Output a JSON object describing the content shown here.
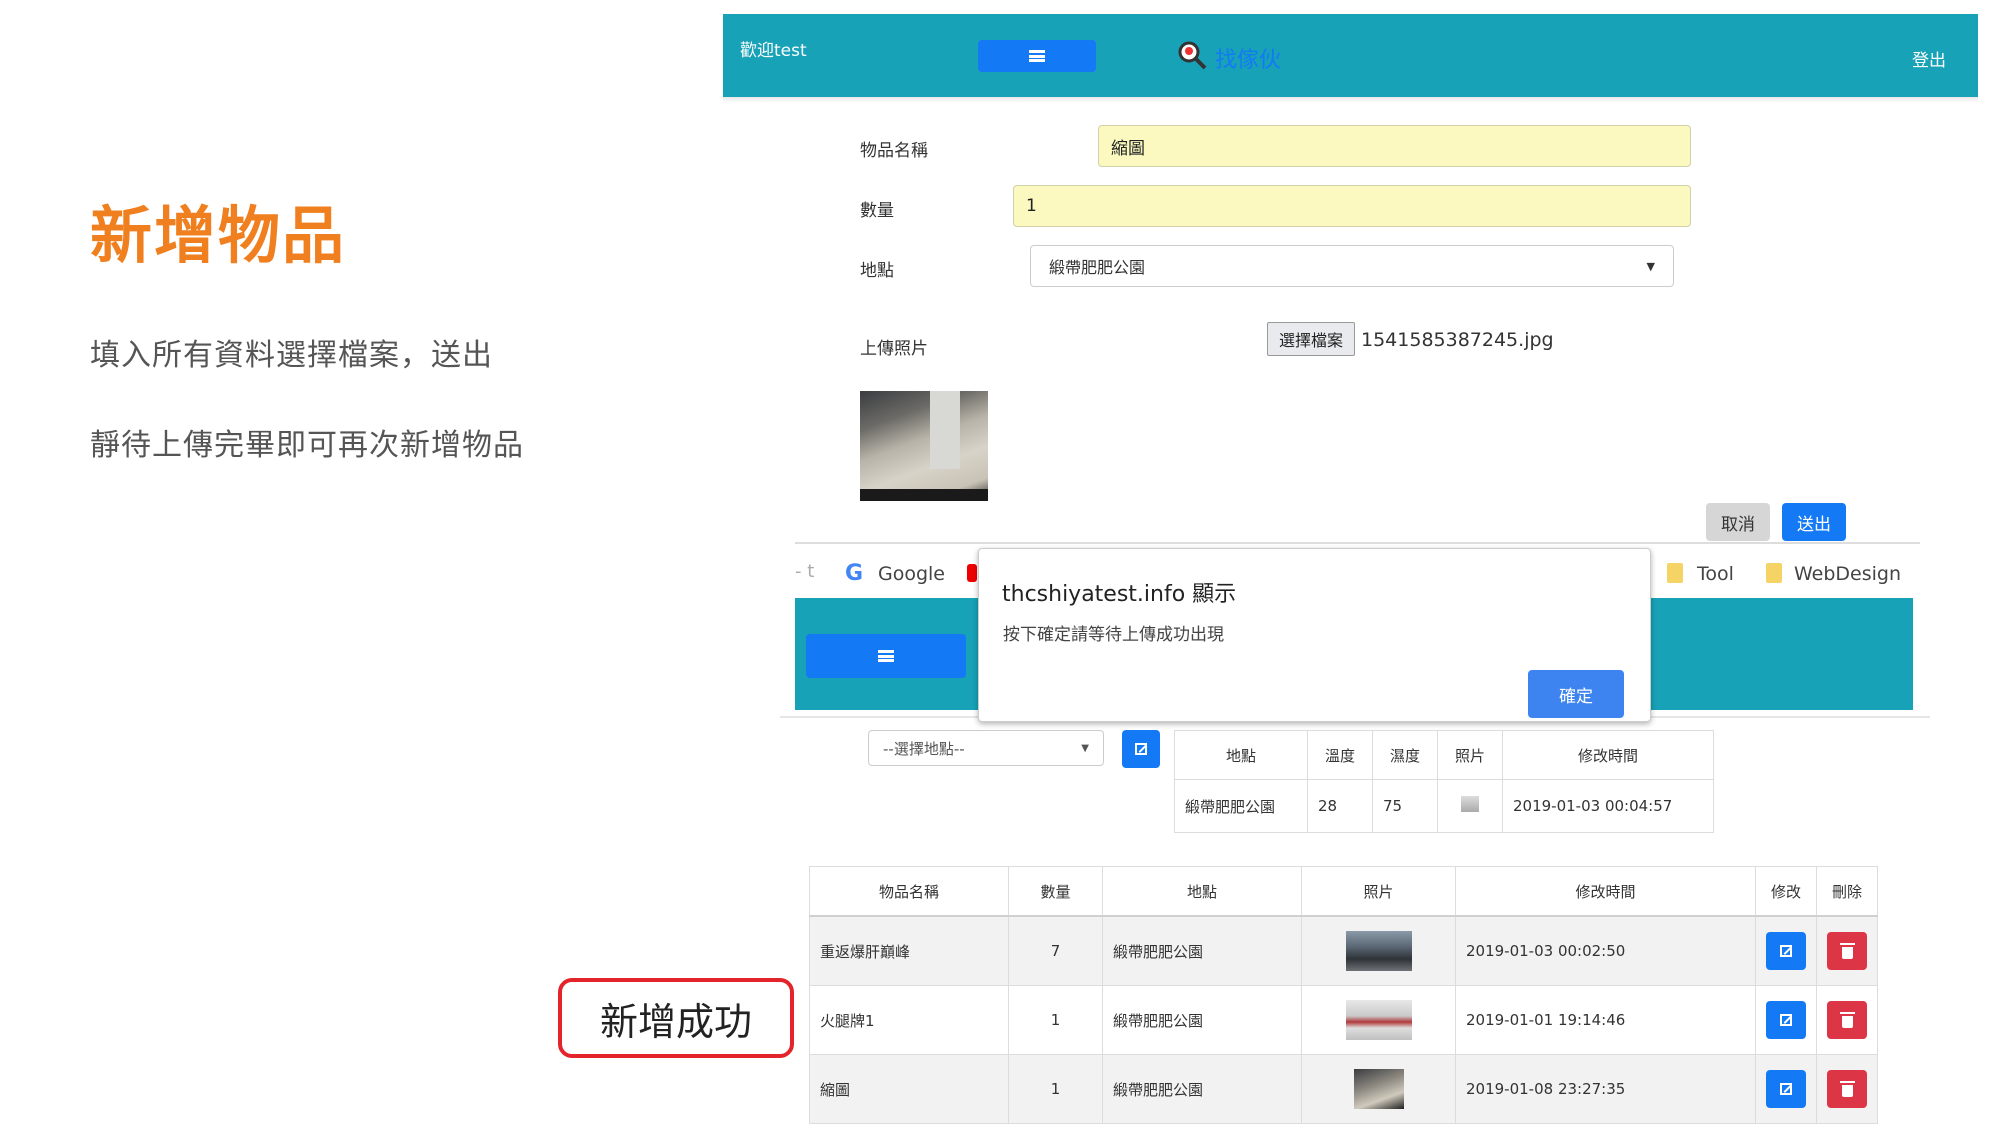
{
  "slide": {
    "title": "新增物品",
    "line1": "填入所有資料選擇檔案，送出",
    "line2": "靜待上傳完畢即可再次新增物品",
    "success_label": "新增成功"
  },
  "app": {
    "welcome": "歡迎test",
    "brand": "找傢伙",
    "logout": "登出",
    "accent_color": "#17a2b8",
    "primary_color": "#1479f5"
  },
  "form": {
    "name_label": "物品名稱",
    "name_value": "縮圖",
    "qty_label": "數量",
    "qty_value": "1",
    "place_label": "地點",
    "place_value": "緞帶肥肥公園",
    "upload_label": "上傳照片",
    "file_button": "選擇檔案",
    "file_name": "1541585387245.jpg",
    "cancel": "取消",
    "submit": "送出"
  },
  "browser": {
    "bookmark_google": "Google",
    "bookmark_tool": "Tool",
    "bookmark_webdesign": "WebDesign",
    "bookmark_dash": "- t"
  },
  "alert": {
    "title": "thcshiyatest.info 顯示",
    "message": "按下確定請等待上傳成功出現",
    "ok": "確定"
  },
  "filter": {
    "placeholder": "--選擇地點--"
  },
  "env_table": {
    "headers": [
      "地點",
      "溫度",
      "濕度",
      "照片",
      "修改時間"
    ],
    "row": {
      "place": "緞帶肥肥公園",
      "temp": "28",
      "humidity": "75",
      "time": "2019-01-03 00:04:57"
    }
  },
  "items_table": {
    "headers": [
      "物品名稱",
      "數量",
      "地點",
      "照片",
      "修改時間",
      "修改",
      "刪除"
    ],
    "rows": [
      {
        "name": "重返爆肝巔峰",
        "qty": "7",
        "place": "緞帶肥肥公園",
        "time": "2019-01-03 00:02:50"
      },
      {
        "name": "火腿牌1",
        "qty": "1",
        "place": "緞帶肥肥公園",
        "time": "2019-01-01 19:14:46"
      },
      {
        "name": "縮圖",
        "qty": "1",
        "place": "緞帶肥肥公園",
        "time": "2019-01-08 23:27:35"
      }
    ]
  }
}
